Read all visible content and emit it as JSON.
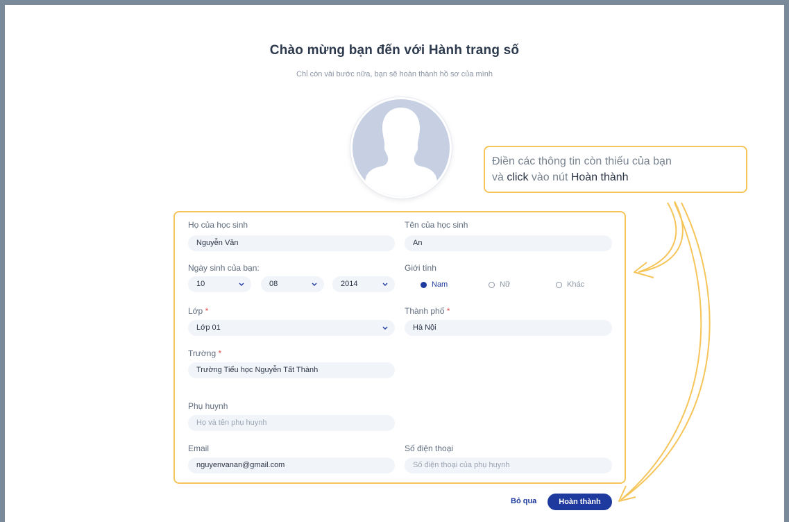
{
  "header": {
    "title": "Chào mừng bạn đến với Hành trang số",
    "subtitle": "Chỉ còn vài bước nữa, bạn sẽ hoàn thành hồ sơ của mình"
  },
  "avatar": {
    "icon": "person-silhouette-icon"
  },
  "callout": {
    "line1": "Điền các thông tin còn thiếu của bạn",
    "line2_pre": "và ",
    "line2_click": "click",
    "line2_mid": " vào nút ",
    "line2_button": "Hoàn thành"
  },
  "form": {
    "last_name": {
      "label": "Họ của học sinh",
      "value": "Nguyễn Văn"
    },
    "first_name": {
      "label": "Tên của học sinh",
      "value": "An"
    },
    "dob": {
      "label": "Ngày sinh của bạn:",
      "day": "10",
      "month": "08",
      "year": "2014"
    },
    "gender": {
      "label": "Giới tính",
      "options": [
        "Nam",
        "Nữ",
        "Khác"
      ],
      "selected": "Nam"
    },
    "class": {
      "label": "Lớp",
      "required_mark": "*",
      "value": "Lớp 01"
    },
    "city": {
      "label": "Thành phố",
      "required_mark": "*",
      "value": "Hà Nội"
    },
    "school": {
      "label": "Trường",
      "required_mark": "*",
      "value": "Trường Tiểu học Nguyễn Tất Thành"
    },
    "parent": {
      "label": "Phụ huynh",
      "placeholder": "Họ và tên phụ huynh"
    },
    "email": {
      "label": "Email",
      "value": "nguyenvanan@gmail.com"
    },
    "phone": {
      "label": "Số điện thoại",
      "placeholder": "Số điện thoại của phụ huynh"
    }
  },
  "actions": {
    "skip_label": "Bỏ qua",
    "done_label": "Hoàn thành"
  },
  "colors": {
    "accent": "#1e3a9e",
    "highlight_border": "#f6c55a",
    "required": "#e04e4e",
    "input_bg": "#f1f4f9"
  }
}
